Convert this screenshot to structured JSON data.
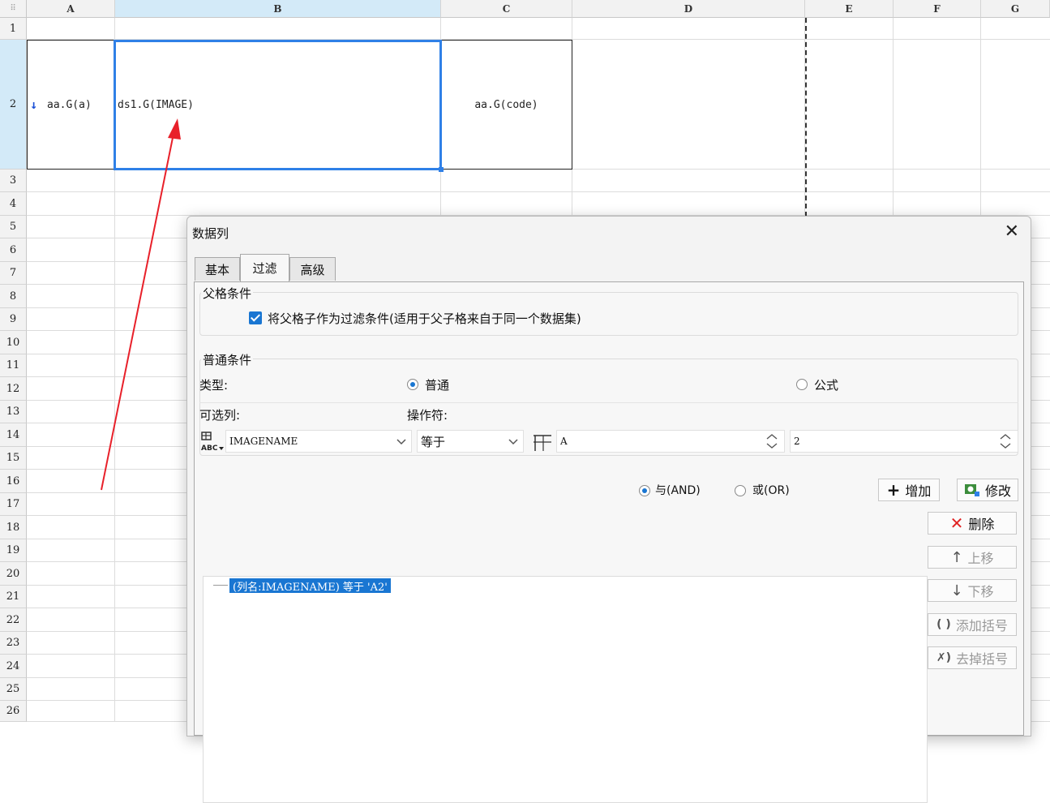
{
  "sheet": {
    "columns": [
      "A",
      "B",
      "C",
      "D",
      "E",
      "F",
      "G"
    ],
    "rows": [
      "1",
      "2",
      "3",
      "4",
      "5",
      "6",
      "7",
      "8",
      "9",
      "10",
      "11",
      "12",
      "13",
      "14",
      "15",
      "16",
      "17",
      "18",
      "19",
      "20",
      "21",
      "22",
      "23",
      "24",
      "25",
      "26"
    ],
    "cells": {
      "a2": "aa.G(a)",
      "b2": "ds1.G(IMAGE)",
      "c2": "aa.G(code)"
    },
    "colors": {
      "selection": "#2f80e7",
      "header_selected": "#d3eaf8",
      "arrow": "#e8202a"
    }
  },
  "dialog": {
    "title": "数据列",
    "tabs": [
      {
        "label": "基本"
      },
      {
        "label": "过滤"
      },
      {
        "label": "高级"
      }
    ],
    "active_tab": "过滤",
    "parent_condition": {
      "group_label": "父格条件",
      "checkbox_checked": true,
      "checkbox_label": "将父格子作为过滤条件(适用于父子格来自于同一个数据集)"
    },
    "normal_condition": {
      "group_label": "普通条件",
      "type_label": "类型:",
      "type_options": [
        {
          "label": "普通",
          "checked": true
        },
        {
          "label": "公式",
          "checked": false
        }
      ],
      "column_label": "可选列:",
      "operator_label": "操作符:",
      "column_value": "IMAGENAME",
      "operator_value": "等于",
      "value_type": "A",
      "value": "2",
      "logic_options": [
        {
          "label": "与(AND)",
          "checked": true
        },
        {
          "label": "或(OR)",
          "checked": false
        }
      ],
      "add_button": "增加",
      "modify_button": "修改"
    },
    "conditions": [
      "(列名:IMAGENAME) 等于 'A2'"
    ],
    "side_buttons": {
      "delete": "删除",
      "move_up": "上移",
      "move_down": "下移",
      "add_bracket": "添加括号",
      "remove_bracket": "去掉括号"
    }
  }
}
